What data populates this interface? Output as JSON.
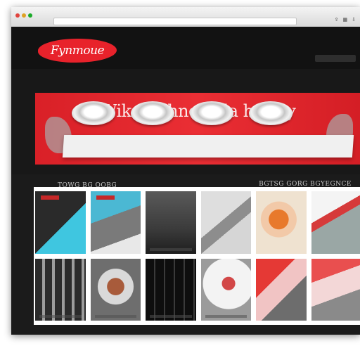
{
  "window": {
    "title": "",
    "chrome_icons": [
      "share-icon",
      "tabs-icon",
      "download-icon"
    ]
  },
  "header": {
    "logo_text": "Fynmoue",
    "top_links": [
      "",
      "",
      ""
    ],
    "top_right": [
      "",
      "",
      ""
    ],
    "nav": [
      "",
      "",
      "",
      "",
      ""
    ]
  },
  "hero": {
    "title": "Wike Puhne gala h Fery",
    "subtitle": "",
    "caption_left": "TOWG BG OOBG",
    "caption_mid": "",
    "caption_right": "BGTSG GORG BGYEGNCE"
  },
  "gallery": {
    "rows": 2,
    "columns": 6
  },
  "colors": {
    "accent": "#e8222b",
    "header_bg": "#121212",
    "page_bg": "#1b1b1b"
  }
}
